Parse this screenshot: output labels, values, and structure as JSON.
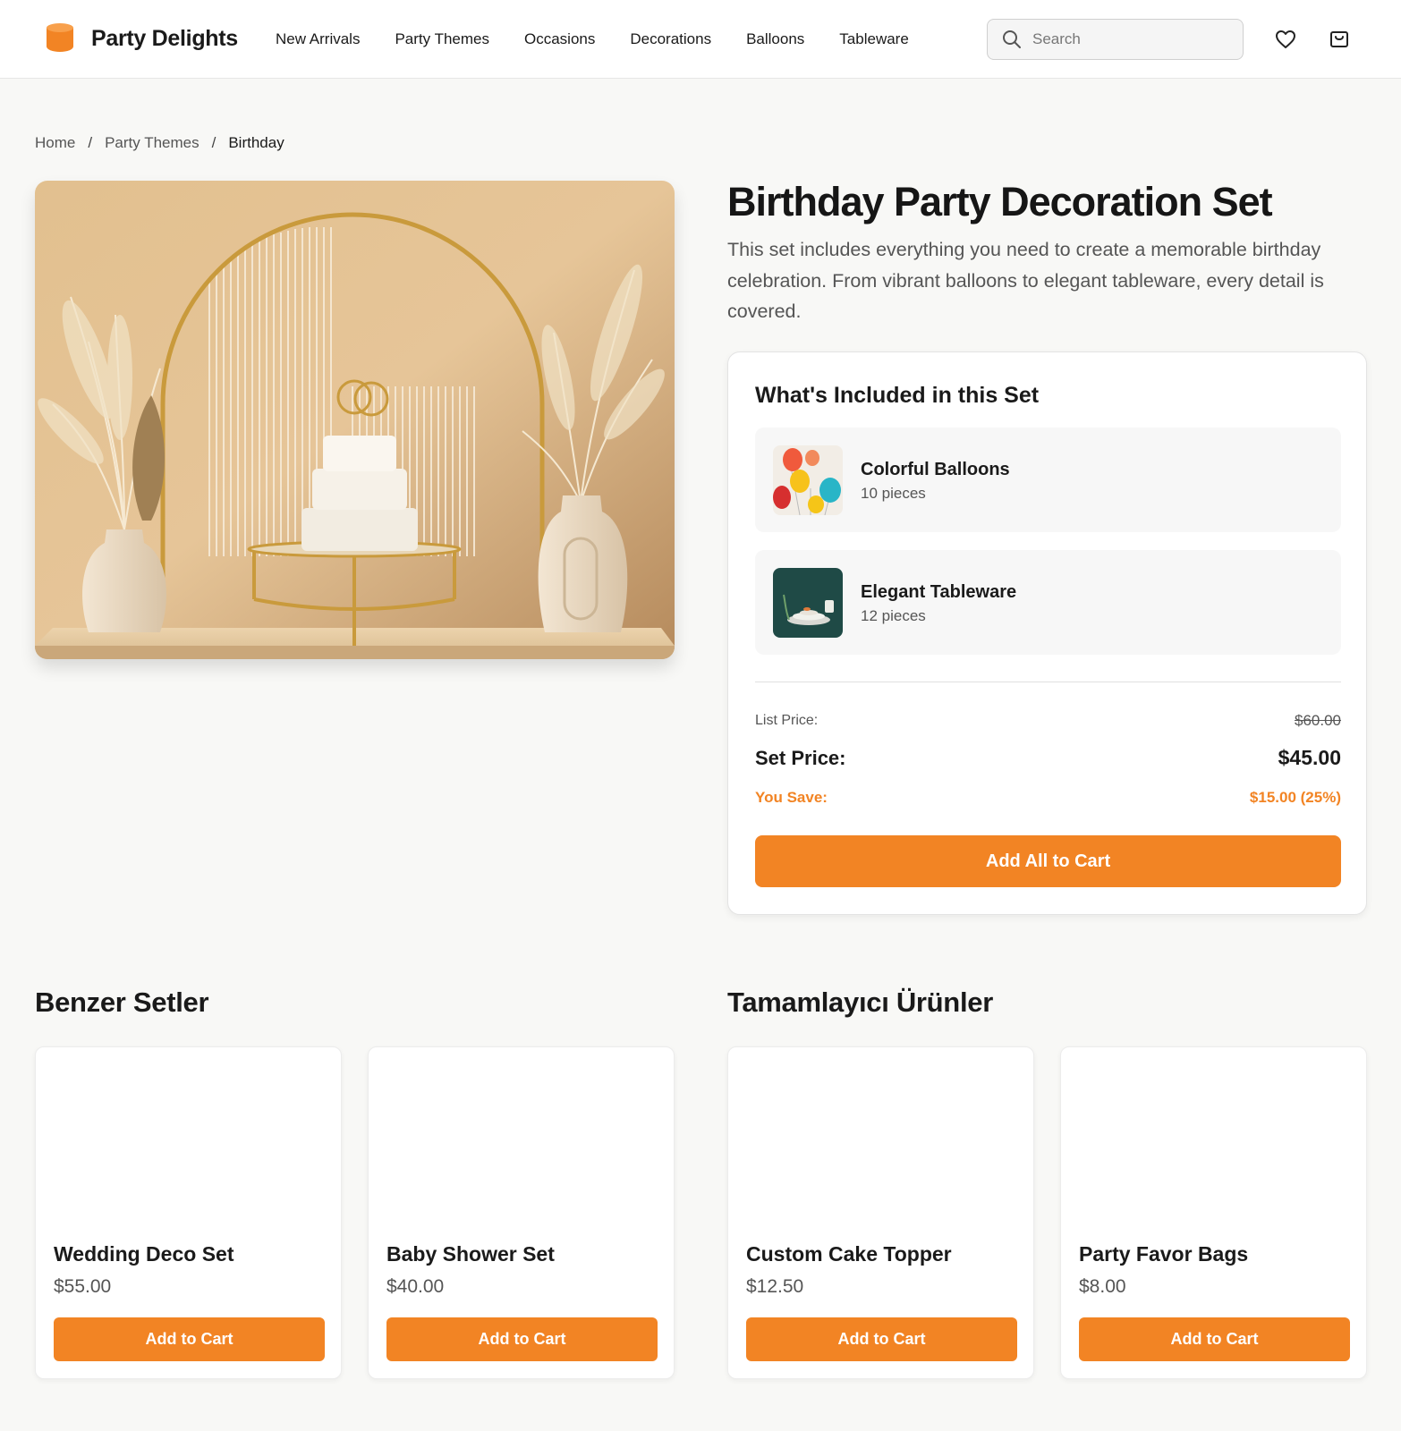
{
  "brand": {
    "name": "Party Delights",
    "accent": "#f28424"
  },
  "nav": {
    "items": [
      "New Arrivals",
      "Party Themes",
      "Occasions",
      "Decorations",
      "Balloons",
      "Tableware"
    ]
  },
  "search": {
    "placeholder": "Search",
    "icon": "search-icon"
  },
  "header_icons": {
    "wishlist": "heart-icon",
    "cart": "shopping-bag-icon"
  },
  "breadcrumb": {
    "items": [
      "Home",
      "Party Themes",
      "Birthday"
    ],
    "separator": "/"
  },
  "product": {
    "title": "Birthday Party Decoration Set",
    "description": "This set includes everything you need to create a memorable birthday celebration. From vibrant balloons to elegant tableware, every detail is covered.",
    "included_title": "What's Included in this Set",
    "included": [
      {
        "name": "Colorful Balloons",
        "qty": "10 pieces"
      },
      {
        "name": "Elegant Tableware",
        "qty": "12 pieces"
      }
    ],
    "pricing": {
      "list_label": "List Price:",
      "list_value": "$60.00",
      "set_label": "Set Price:",
      "set_value": "$45.00",
      "save_label": "You Save:",
      "save_value": "$15.00 (25%)"
    },
    "add_all_label": "Add All to Cart"
  },
  "similar": {
    "title": "Benzer Setler",
    "items": [
      {
        "name": "Wedding Deco Set",
        "price": "$55.00",
        "button": "Add to Cart"
      },
      {
        "name": "Baby Shower Set",
        "price": "$40.00",
        "button": "Add to Cart"
      }
    ]
  },
  "complementary": {
    "title": "Tamamlayıcı Ürünler",
    "items": [
      {
        "name": "Custom Cake Topper",
        "price": "$12.50",
        "button": "Add to Cart"
      },
      {
        "name": "Party Favor Bags",
        "price": "$8.00",
        "button": "Add to Cart"
      }
    ]
  }
}
